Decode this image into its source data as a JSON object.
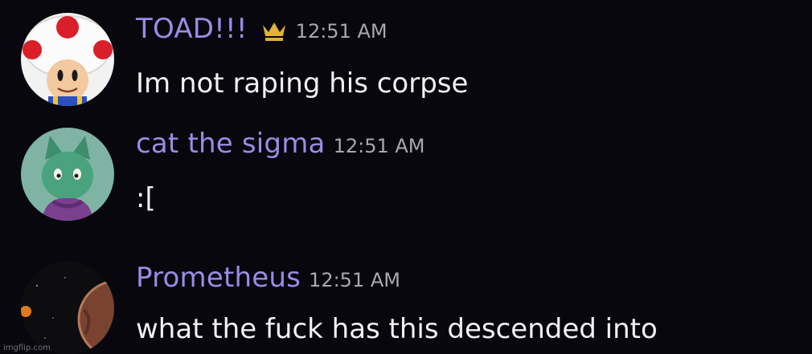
{
  "messages": [
    {
      "username": "TOAD!!!",
      "badge_icon": "crown-icon",
      "timestamp": "12:51 AM",
      "text": "Im not raping his corpse"
    },
    {
      "username": "cat the sigma",
      "timestamp": "12:51 AM",
      "text": ":["
    },
    {
      "username": "Prometheus",
      "timestamp": "12:51 AM",
      "text": "what the fuck has this descended into"
    }
  ],
  "watermark": "imgflip.com",
  "colors": {
    "background": "#07070d",
    "username": "#9a8ce6",
    "timestamp": "#a7a8b0",
    "message_text": "#f1f1f3",
    "crown": "#e2b13c"
  }
}
